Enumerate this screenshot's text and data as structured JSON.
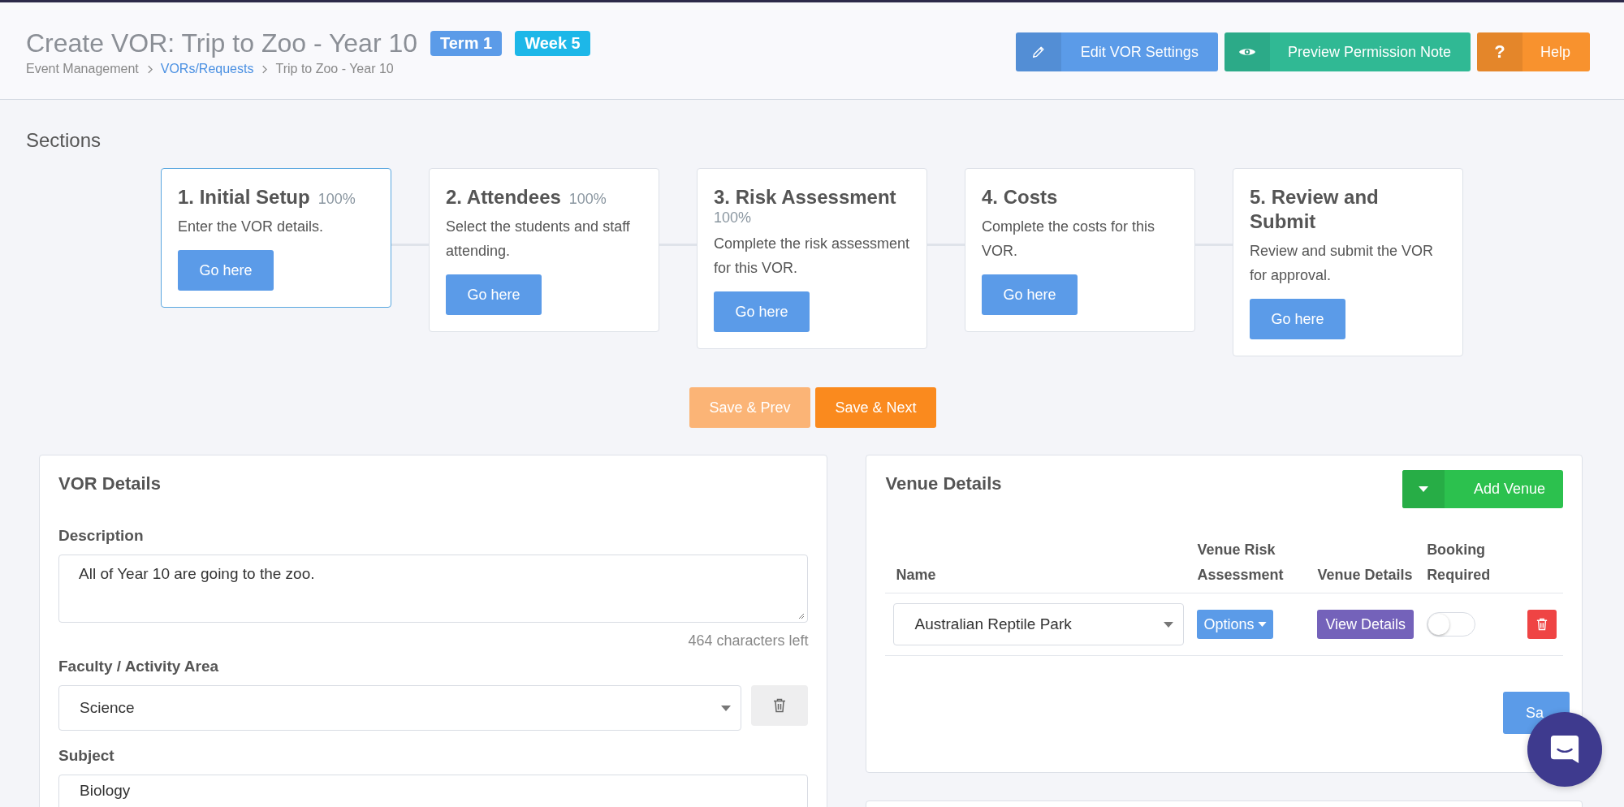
{
  "header": {
    "title": "Create VOR: Trip to Zoo - Year 10",
    "badges": [
      {
        "label": "Term 1",
        "color": "#5b9be8"
      },
      {
        "label": "Week 5",
        "color": "#1db7e8"
      }
    ],
    "breadcrumbs": [
      {
        "label": "Event Management",
        "link": false
      },
      {
        "label": "VORs/Requests",
        "link": true
      },
      {
        "label": "Trip to Zoo - Year 10",
        "link": false
      }
    ],
    "buttons": [
      {
        "label": "Edit VOR Settings",
        "kind": "pencil",
        "color": "#5b9be8"
      },
      {
        "label": "Preview Permission Note",
        "kind": "eye",
        "color": "#30b994"
      },
      {
        "label": "Help",
        "kind": "question",
        "icon_text": "?",
        "color": "#f8922e"
      }
    ]
  },
  "sections": {
    "title": "Sections",
    "steps": [
      {
        "title": "1. Initial Setup",
        "percent": "100%",
        "description": "Enter the VOR details.",
        "button": "Go here",
        "selected": true
      },
      {
        "title": "2. Attendees",
        "percent": "100%",
        "description": "Select the students and staff attending.",
        "button": "Go here",
        "selected": false
      },
      {
        "title": "3. Risk Assessment",
        "percent": "100%",
        "description": "Complete the risk assessment for this VOR.",
        "button": "Go here",
        "selected": false
      },
      {
        "title": "4. Costs",
        "description": "Complete the costs for this VOR.",
        "button": "Go here",
        "selected": false
      },
      {
        "title": "5. Review and Submit",
        "description": "Review and submit the VOR for approval.",
        "button": "Go here",
        "selected": false
      }
    ]
  },
  "nav_buttons": [
    {
      "label": "Save & Prev",
      "disabled": true
    },
    {
      "label": "Save & Next",
      "disabled": false
    }
  ],
  "vor_details": {
    "title": "VOR Details",
    "description": {
      "label": "Description",
      "value": "All of Year 10 are going to the zoo.",
      "counter": "464 characters left"
    },
    "faculty": {
      "label": "Faculty / Activity Area",
      "value": "Science"
    },
    "subject": {
      "label": "Subject",
      "value": "Biology"
    }
  },
  "venue_details": {
    "title": "Venue Details",
    "add_button": "Add Venue",
    "columns": [
      "Name",
      "Venue Risk Assessment",
      "Venue Details",
      "Booking Required"
    ],
    "rows": [
      {
        "name": "Australian Reptile Park",
        "options": "Options",
        "view": "View Details",
        "booking_required": false
      }
    ],
    "save_button": "Sa"
  }
}
